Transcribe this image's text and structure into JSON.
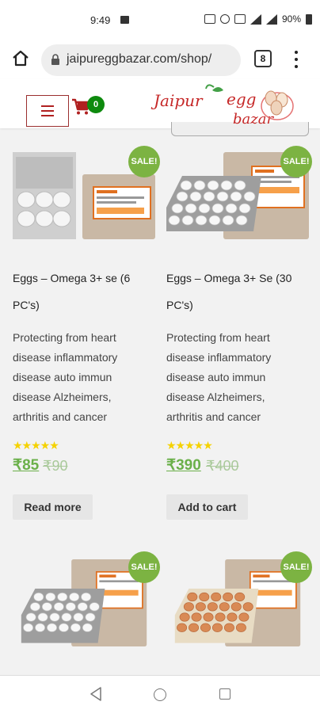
{
  "status_bar": {
    "time": "9:49",
    "battery_percent": "90%"
  },
  "browser": {
    "url": "jaipureggbazar.com/shop/",
    "tab_count": "8"
  },
  "header": {
    "cart_count": "0",
    "logo_line1": "Jaipur",
    "logo_line2": "egg",
    "logo_line3": "bazar"
  },
  "colors": {
    "accent_green": "#6bb04a",
    "sale_badge": "#7cb342",
    "cart_red": "#b02020",
    "cart_badge": "#0e8a0e",
    "star": "#f5d200"
  },
  "products": [
    {
      "sale": "SALE!",
      "title_line1": "Eggs – Omega 3+ se (6",
      "title_line2": "PC's)",
      "desc": [
        "Protecting from heart",
        "disease inflammatory",
        "disease auto immun",
        "disease Alzheimers,",
        "arthritis and cancer"
      ],
      "stars": "★★★★★",
      "rating": 5,
      "price": "₹85",
      "old_price": "₹90",
      "button": "Read more"
    },
    {
      "sale": "SALE!",
      "title_line1": "Eggs – Omega 3+ Se (30",
      "title_line2": "PC's)",
      "desc": [
        "Protecting from heart",
        "disease inflammatory",
        "disease auto immun",
        "disease Alzheimers,",
        "arthritis and cancer"
      ],
      "stars": "★★★★★",
      "rating": 5,
      "price": "₹390",
      "old_price": "₹400",
      "button": "Add to cart"
    },
    {
      "sale": "SALE!"
    },
    {
      "sale": "SALE!"
    }
  ]
}
